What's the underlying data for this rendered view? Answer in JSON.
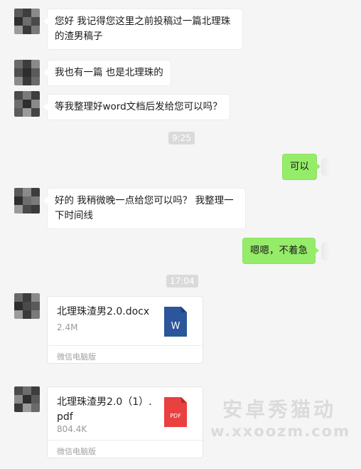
{
  "messages": {
    "msg1": "您好 我记得您这里之前投稿过一篇北理珠\n的渣男稿子",
    "msg2": "我也有一篇 也是北理珠的",
    "msg3": "等我整理好word文档后发给您可以吗？",
    "time1": "9:25",
    "msg4": "可以",
    "msg5": "好的 我稍微晚一点给您可以吗？ 我整理一\n下时间线",
    "msg6": "嗯嗯，不着急",
    "time2": "17:04"
  },
  "files": [
    {
      "name": "北理珠渣男2.0.docx",
      "size": "2.4M",
      "source": "微信电脑版",
      "icon": "word-icon",
      "icon_letter": "W",
      "color": "#2b579a"
    },
    {
      "name": "北理珠渣男2.0（1）.\npdf",
      "size": "804.4K",
      "source": "微信电脑版",
      "icon": "pdf-icon",
      "icon_letter": "PDF",
      "color": "#e94040"
    }
  ],
  "watermark": {
    "cn": "安卓秀猫动",
    "en": "w.xxoozm.com"
  },
  "colors": {
    "outgoing_bubble": "#95ec69",
    "background": "#f5f5f5"
  }
}
